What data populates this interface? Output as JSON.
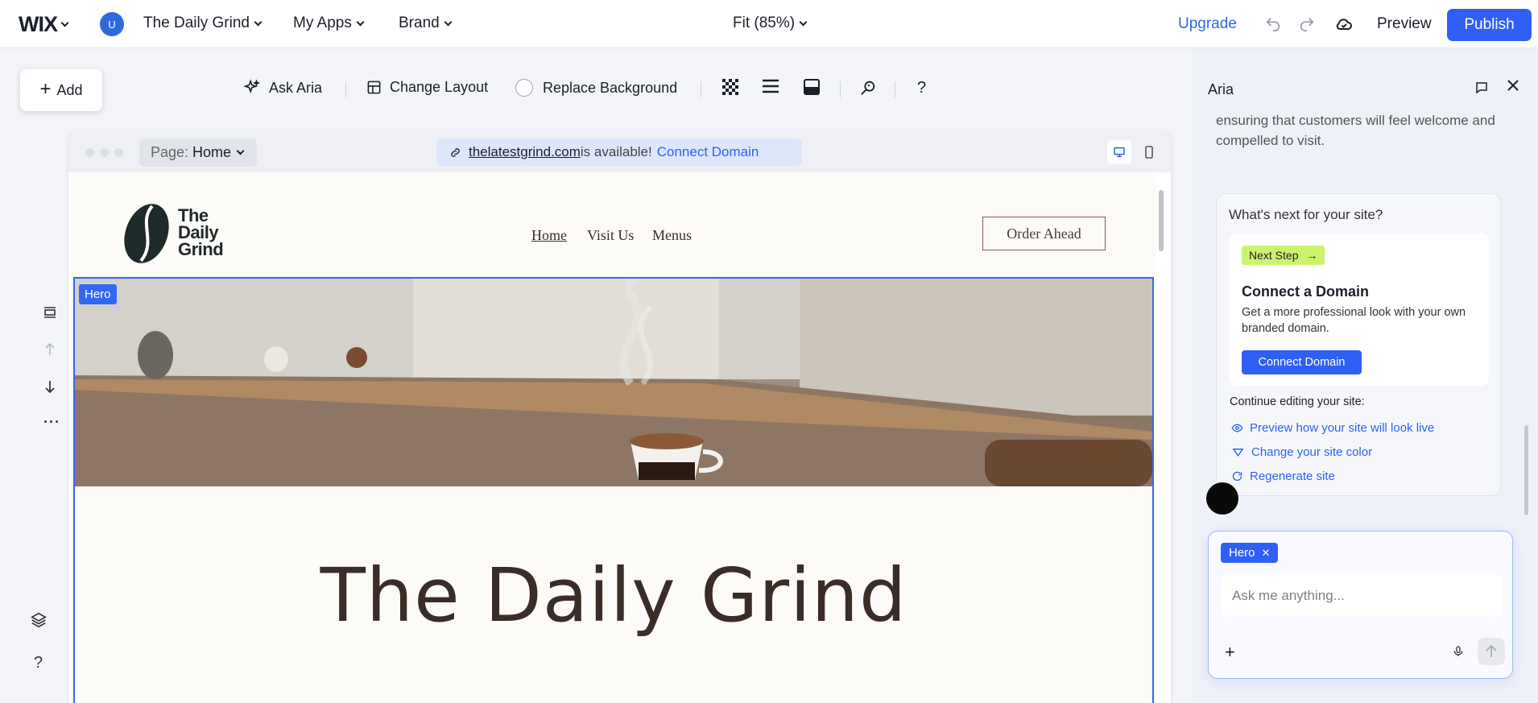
{
  "topbar": {
    "logo": "WIX",
    "avatar_initial": "U",
    "site_name": "The Daily Grind",
    "my_apps": "My Apps",
    "brand": "Brand",
    "zoom": "Fit (85%)",
    "upgrade": "Upgrade",
    "preview": "Preview",
    "publish": "Publish"
  },
  "toolbar": {
    "add": "Add",
    "ask_aria": "Ask Aria",
    "change_layout": "Change Layout",
    "replace_background": "Replace Background"
  },
  "canvas": {
    "page_label": "Page:",
    "page_value": "Home",
    "domain": "thelatestgrind.com",
    "domain_status": "is available!",
    "connect_domain": "Connect Domain"
  },
  "site": {
    "logo_lines": [
      "The",
      "Daily",
      "Grind"
    ],
    "nav": [
      "Home",
      "Visit Us",
      "Menus"
    ],
    "order_ahead": "Order Ahead",
    "hero_tag": "Hero",
    "hero_title": "The Daily Grind"
  },
  "aria": {
    "title": "Aria",
    "previous_message": "ensuring that customers will feel welcome and compelled to visit.",
    "next_question": "What's next for your site?",
    "next_badge": "Next Step",
    "card_title": "Connect a Domain",
    "card_text": "Get a more professional look with your own branded domain.",
    "card_button": "Connect Domain",
    "continue_label": "Continue editing your site:",
    "links": [
      "Preview how your site will look live",
      "Change your site color",
      "Regenerate site"
    ],
    "chip": "Hero",
    "input_placeholder": "Ask me anything..."
  },
  "colors": {
    "accent": "#2f5ff5",
    "hero_outline": "#3368f5",
    "next_badge": "#ccf36e"
  }
}
